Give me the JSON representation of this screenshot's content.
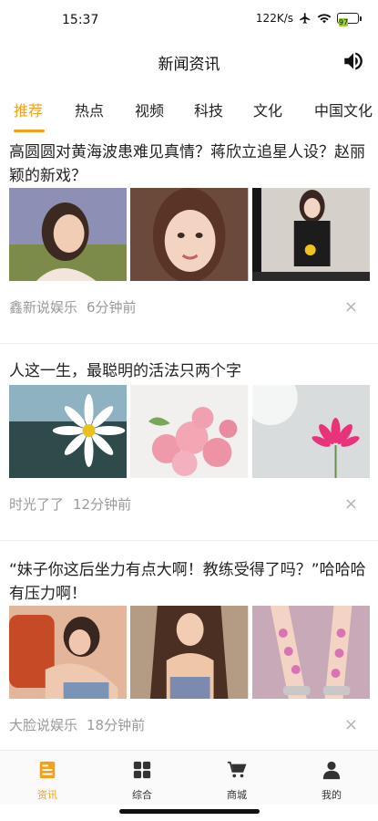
{
  "status_bar": {
    "time": "15:37",
    "network_speed": "122K/s",
    "battery_level": "97",
    "icons": [
      "airplane-icon",
      "wifi-icon",
      "battery-icon"
    ]
  },
  "header": {
    "title": "新闻资讯",
    "action_icon": "speaker-icon"
  },
  "tabs": [
    {
      "label": "推荐",
      "active": true
    },
    {
      "label": "热点",
      "active": false
    },
    {
      "label": "视频",
      "active": false
    },
    {
      "label": "科技",
      "active": false
    },
    {
      "label": "文化",
      "active": false
    },
    {
      "label": "中国文化",
      "active": false
    }
  ],
  "articles": [
    {
      "title": "高圆圆对黄海波患难见真情？蒋欣立追星人设？赵丽颖的新戏？",
      "source": "鑫新说娱乐",
      "time": "6分钟前",
      "images": [
        "portrait-photo",
        "portrait-photo",
        "portrait-photo"
      ]
    },
    {
      "title": "人这一生，最聪明的活法只两个字",
      "source": "时光了了",
      "time": "12分钟前",
      "images": [
        "daisy-photo",
        "roses-photo",
        "pink-flower-photo"
      ]
    },
    {
      "title": "“妹子你这后坐力有点大啊！教练受得了吗？”哈哈哈有压力啊！",
      "source": "大脸说娱乐",
      "time": "18分钟前",
      "images": [
        "person-photo",
        "person-photo",
        "shoes-photo"
      ]
    }
  ],
  "close_symbol": "×",
  "bottom_nav": [
    {
      "label": "资讯",
      "icon": "news-icon",
      "active": true
    },
    {
      "label": "综合",
      "icon": "grid-icon",
      "active": false
    },
    {
      "label": "商城",
      "icon": "cart-icon",
      "active": false
    },
    {
      "label": "我的",
      "icon": "person-icon",
      "active": false
    }
  ],
  "colors": {
    "accent": "#f2a11b",
    "meta_text": "#9a9a9a",
    "battery": "#9ad13b"
  }
}
